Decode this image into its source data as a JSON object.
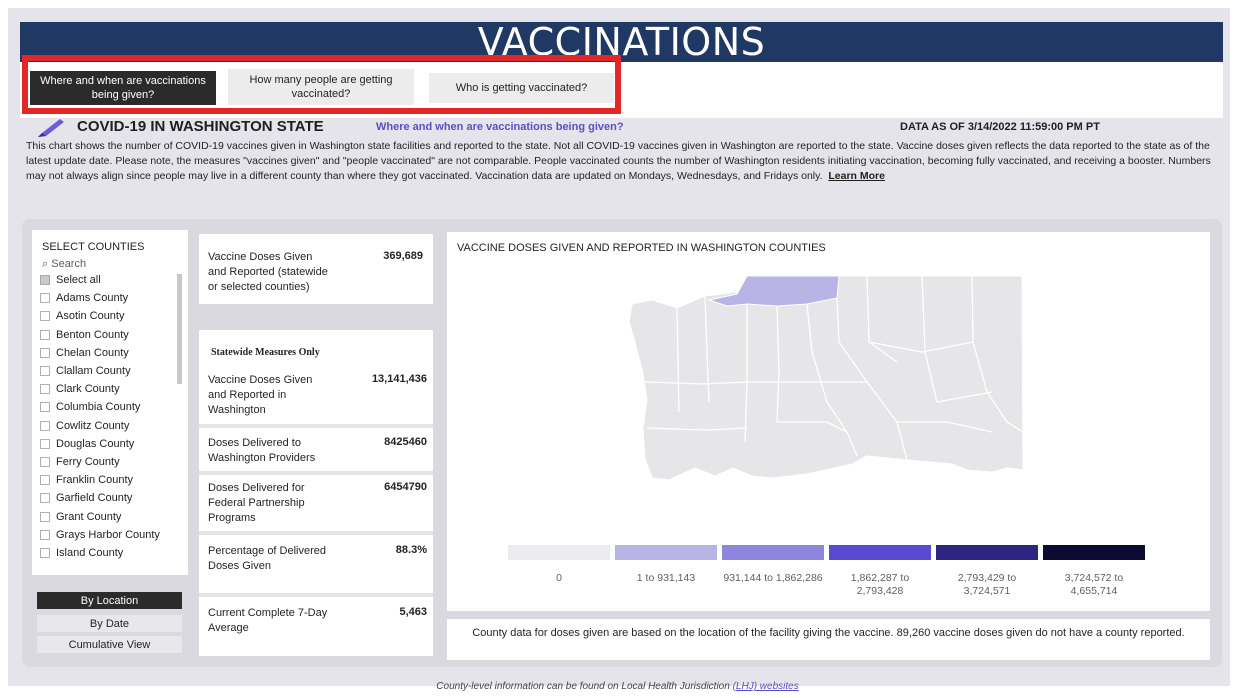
{
  "banner": {
    "title": "VACCINATIONS"
  },
  "nav": {
    "tab1": "Where and when are vaccinations being given?",
    "tab2": "How many people are getting vaccinated?",
    "tab3": "Who is getting vaccinated?"
  },
  "header": {
    "title": "COVID-19 IN WASHINGTON STATE",
    "subtitle": "Where and when are vaccinations being given?",
    "date": "DATA AS OF 3/14/2022 11:59:00 PM PT",
    "description": "This chart shows the number of COVID-19 vaccines given in Washington state facilities and reported to the state. Not all COVID-19 vaccines given in Washington are reported to the state. Vaccine doses given reflects the data reported to the state as of the latest update date. Please note, the measures \"vaccines given\" and \"people vaccinated\" are not comparable. People vaccinated counts the number of Washington residents initiating vaccination, becoming fully vaccinated, and receiving a booster. Numbers may not always align since people may live in a different county than where they got vaccinated. Vaccination data are updated on Mondays, Wednesdays, and Fridays only.",
    "learn_more": "Learn More"
  },
  "slicer": {
    "title": "SELECT COUNTIES",
    "search_placeholder": "Search",
    "items": [
      "Select all",
      "Adams County",
      "Asotin County",
      "Benton County",
      "Chelan County",
      "Clallam County",
      "Clark County",
      "Columbia County",
      "Cowlitz County",
      "Douglas County",
      "Ferry County",
      "Franklin County",
      "Garfield County",
      "Grant County",
      "Grays Harbor County",
      "Island County"
    ]
  },
  "views": {
    "location": "By Location",
    "date": "By Date",
    "cumulative": "Cumulative View"
  },
  "kpi": {
    "label": "Vaccine Doses Given and Reported (statewide or selected counties)",
    "value": "369,689"
  },
  "measures": {
    "heading": "Statewide Measures Only",
    "items": [
      {
        "label": "Vaccine Doses Given and Reported in Washington",
        "value": "13,141,436"
      },
      {
        "label": "Doses Delivered to Washington Providers",
        "value": "8425460"
      },
      {
        "label": "Doses Delivered for Federal Partnership Programs",
        "value": "6454790"
      },
      {
        "label": "Percentage of Delivered Doses Given",
        "value": "88.3%"
      },
      {
        "label": "Current Complete 7-Day Average",
        "value": "5,463"
      }
    ]
  },
  "map": {
    "title": "VACCINE DOSES GIVEN AND REPORTED IN WASHINGTON COUNTIES",
    "legend": [
      {
        "label": "0",
        "color": "#ececf0"
      },
      {
        "label": "1 to 931,143",
        "color": "#b9b4e6"
      },
      {
        "label": "931,144 to 1,862,286",
        "color": "#8e86dc"
      },
      {
        "label": "1,862,287 to 2,793,428",
        "color": "#5a4ad1"
      },
      {
        "label": "2,793,429 to 3,724,571",
        "color": "#2e2580"
      },
      {
        "label": "3,724,572 to 4,655,714",
        "color": "#0e0b33"
      }
    ],
    "note": "County data for doses given are based on the location of the facility giving the vaccine. 89,260 vaccine doses given do not have a county reported."
  },
  "footer": {
    "text": "County-level information can be found on Local Health Jurisdiction",
    "link": "(LHJ) websites"
  }
}
